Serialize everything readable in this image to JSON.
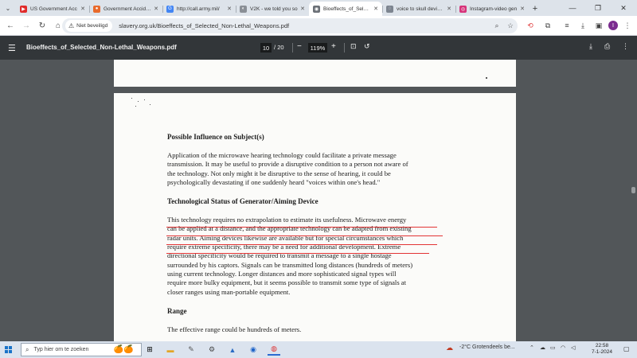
{
  "tabs": [
    {
      "label": "US Government Acc",
      "favicon_color": "#e02b2b",
      "favicon_glyph": "▶",
      "active": false
    },
    {
      "label": "Government Acciden",
      "favicon_color": "#e86a2c",
      "favicon_glyph": "●",
      "active": false
    },
    {
      "label": "http://call.army.mil/",
      "favicon_color": "#4285f4",
      "favicon_glyph": "G",
      "active": false
    },
    {
      "label": "V2K - we told you so",
      "favicon_color": "#8a8f96",
      "favicon_glyph": "◐",
      "active": false
    },
    {
      "label": "Bioeffects_of_Selecte",
      "favicon_color": "#6b7077",
      "favicon_glyph": "◉",
      "active": true
    },
    {
      "label": "voice to skull devices",
      "favicon_color": "#7d8590",
      "favicon_glyph": "◌",
      "active": false
    },
    {
      "label": "Instagram-video gen",
      "favicon_color": "#d6337a",
      "favicon_glyph": "◎",
      "active": false
    }
  ],
  "address_bar": {
    "security_label": "Niet beveiligd",
    "url": "slavery.org.uk/Bioeffects_of_Selected_Non-Lethal_Weapons.pdf"
  },
  "pdf_toolbar": {
    "title": "Bioeffects_of_Selected_Non-Lethal_Weapons.pdf",
    "current_page": "10",
    "page_separator": "/",
    "total_pages": "20",
    "zoom": "119%"
  },
  "document": {
    "heading1": "Possible Influence on Subject(s)",
    "para1_lines": [
      "Application of the microwave hearing technology could facilitate a private message",
      "transmission. It may be useful to provide a disruptive condition to a person not aware of",
      "the technology. Not only might it be disruptive to the sense of hearing, it could be",
      "psychologically devastating if one suddenly heard \"voices within one's head.\""
    ],
    "heading2": "Technological Status of Generator/Aiming Device",
    "para2_lines": [
      "This technology requires no extrapolation to estimate its usefulness. Microwave energy",
      "can be applied at a distance, and the appropriate technology can be adapted from existing",
      "radar units. Aiming devices likewise are available but for special circumstances which",
      "require extreme specificity, there may be a need for additional development. Extreme",
      "directional specificity would be required to transmit a message to a single hostage",
      "surrounded by his captors. Signals can be transmitted long distances (hundreds of meters)",
      "using current technology. Longer distances and more sophisticated signal types will",
      "require more bulky equipment, but it seems possible to transmit some type of signals at",
      "closer ranges using man-portable equipment."
    ],
    "heading3": "Range",
    "para3": "The effective range could be hundreds of meters."
  },
  "taskbar": {
    "search_placeholder": "Typ hier om te zoeken",
    "weather": "-2°C  Grotendeels be...",
    "time": "22:58",
    "date": "7-1-2024"
  },
  "colors": {
    "underline_red": "#e23434",
    "pdf_toolbar_bg": "#323639",
    "viewer_bg": "#525659"
  }
}
